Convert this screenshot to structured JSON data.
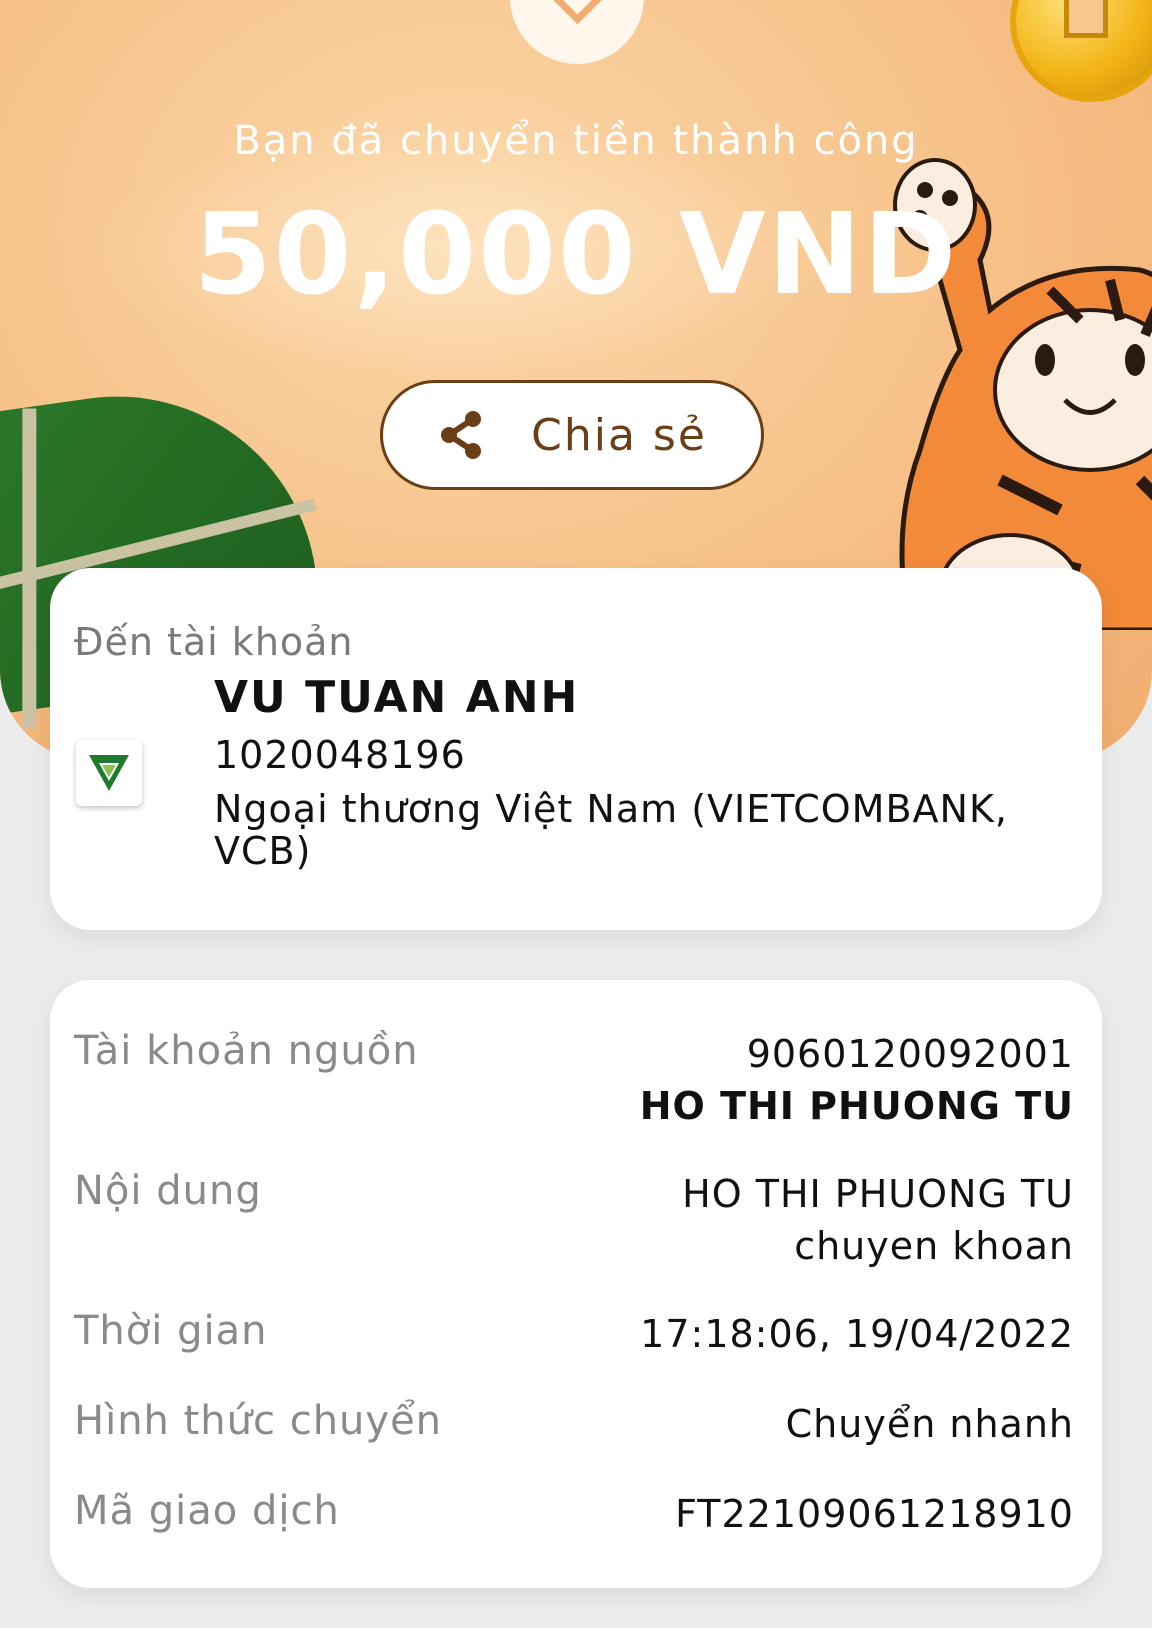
{
  "header": {
    "success_message": "Bạn đã chuyển tiền thành công",
    "amount": "50,000 VND",
    "share_label": "Chia sẻ",
    "share_icon": "share-icon"
  },
  "recipient": {
    "section_label": "Đến tài khoản",
    "name": "VU TUAN ANH",
    "account_number": "1020048196",
    "bank_name": "Ngoại thương Việt Nam (VIETCOMBANK, VCB)",
    "bank_logo_icon": "vietcombank-logo"
  },
  "details": {
    "source_account": {
      "label": "Tài khoản nguồn",
      "account_number": "9060120092001",
      "owner_name": "HO THI PHUONG TU"
    },
    "content": {
      "label": "Nội dung",
      "line1": "HO THI PHUONG TU",
      "line2": "chuyen khoan"
    },
    "time": {
      "label": "Thời gian",
      "value": "17:18:06, 19/04/2022"
    },
    "transfer_type": {
      "label": "Hình thức chuyển",
      "value": "Chuyển nhanh"
    },
    "transaction_id": {
      "label": "Mã giao dịch",
      "value": "FT22109061218910"
    }
  },
  "colors": {
    "hero_orange": "#f7c58e",
    "share_brown": "#6b3f16",
    "vcb_green": "#1f7a2e"
  }
}
